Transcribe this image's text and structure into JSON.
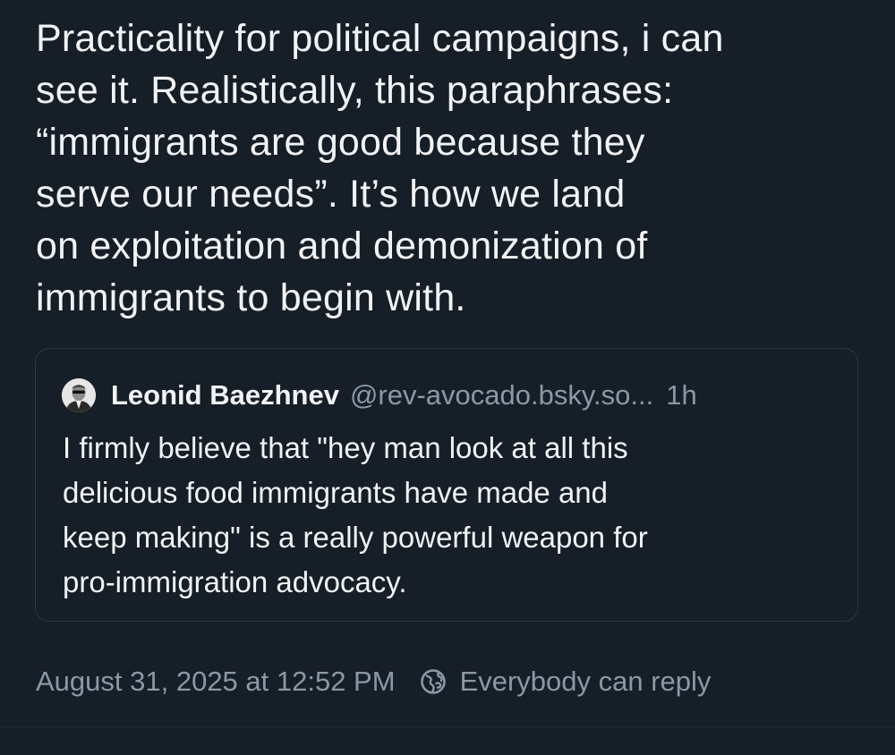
{
  "post": {
    "text_lines": [
      "Practicality for political campaigns, i can",
      "see it. Realistically, this paraphrases:",
      "“immigrants are good because they",
      "serve our needs”. It’s how we land",
      "on exploitation and demonization of",
      "immigrants to begin with."
    ],
    "timestamp": "August 31, 2025 at 12:52 PM",
    "reply_setting": "Everybody can reply",
    "reply_icon": "globe-icon"
  },
  "quote": {
    "author_name": "Leonid Baezhnev",
    "author_handle": "@rev-avocado.bsky.so...",
    "age": "1h",
    "avatar_icon": "avatar",
    "text_lines": [
      "I firmly believe that \"hey man look at all this",
      "delicious food immigrants have made and",
      "keep making\" is a really powerful weapon for",
      "pro-immigration advocacy."
    ]
  },
  "colors": {
    "background": "#161e27",
    "text_primary": "#f1f3f5",
    "text_secondary": "#8b98a7",
    "border": "#2c3845"
  }
}
